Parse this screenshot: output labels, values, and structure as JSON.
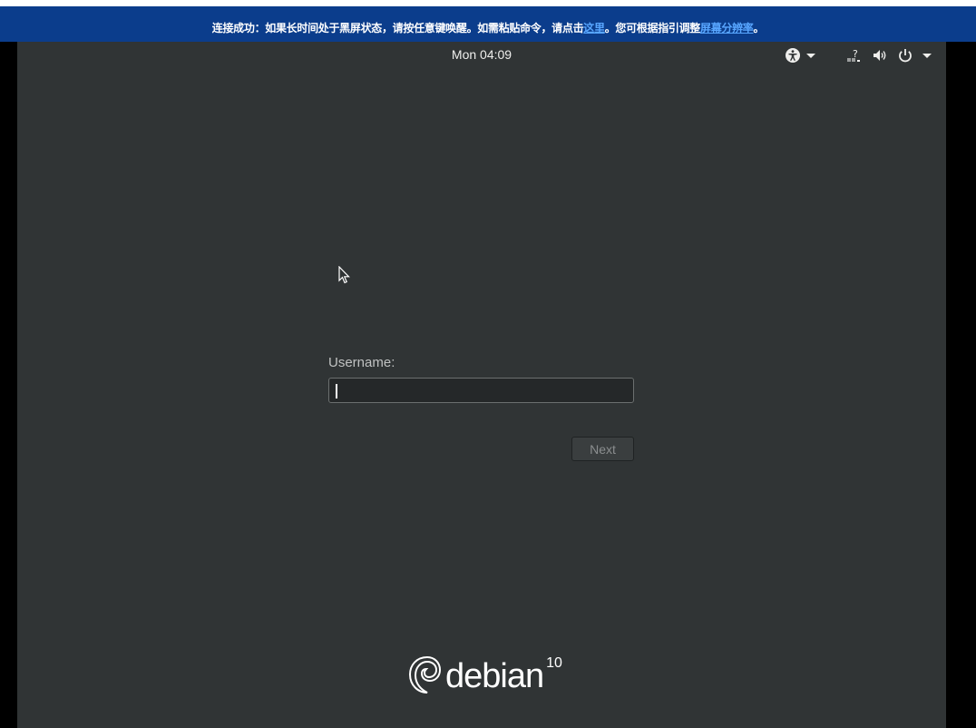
{
  "banner": {
    "text_before": "连接成功：如果长时间处于黑屏状态，请按任意键唤醒。如需粘贴命令，请点击",
    "link_here": "这里",
    "text_middle": "。您可根据指引调整",
    "link_resolution": "屏幕分辨率",
    "text_after": "。"
  },
  "topbar": {
    "clock": "Mon 04:09",
    "icons": [
      "accessibility-icon",
      "network-unknown-icon",
      "volume-icon",
      "power-icon"
    ]
  },
  "login": {
    "username_label": "Username:",
    "username_value": "",
    "next_label": "Next"
  },
  "branding": {
    "logo_text": "debian",
    "version": "10"
  },
  "colors": {
    "banner_bg": "#0b3d8c",
    "link": "#58a6ff",
    "screen_bg": "#303435",
    "input_bg": "#252829"
  }
}
